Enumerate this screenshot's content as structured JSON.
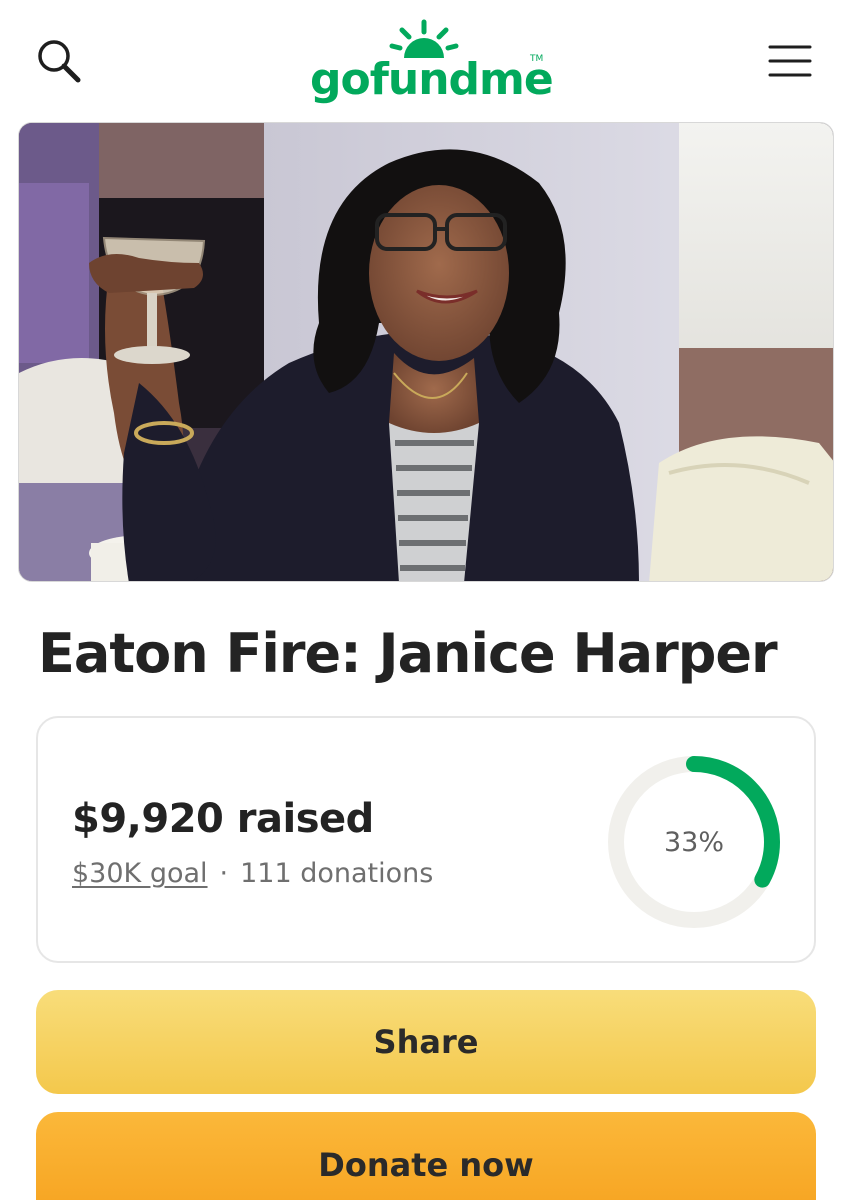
{
  "header": {
    "logo_text": "gofundme",
    "logo_tm": "TM",
    "search_icon": "search-icon",
    "menu_icon": "hamburger-menu-icon"
  },
  "hero": {
    "image": "campaign-photo"
  },
  "campaign": {
    "title": "Eaton Fire: Janice Harper"
  },
  "progress": {
    "raised_text": "$9,920 raised",
    "goal_text": "$30K goal",
    "separator": "·",
    "donations_text": "111 donations",
    "percent_text": "33%",
    "percent_value": 0.33,
    "ring_color": "#02a95c",
    "track_color": "#f1f0ec"
  },
  "actions": {
    "share_label": "Share",
    "donate_label": "Donate now"
  },
  "colors": {
    "brand_green": "#02a95c",
    "share_yellow": "#f6d469",
    "donate_orange": "#f8ab2a"
  }
}
